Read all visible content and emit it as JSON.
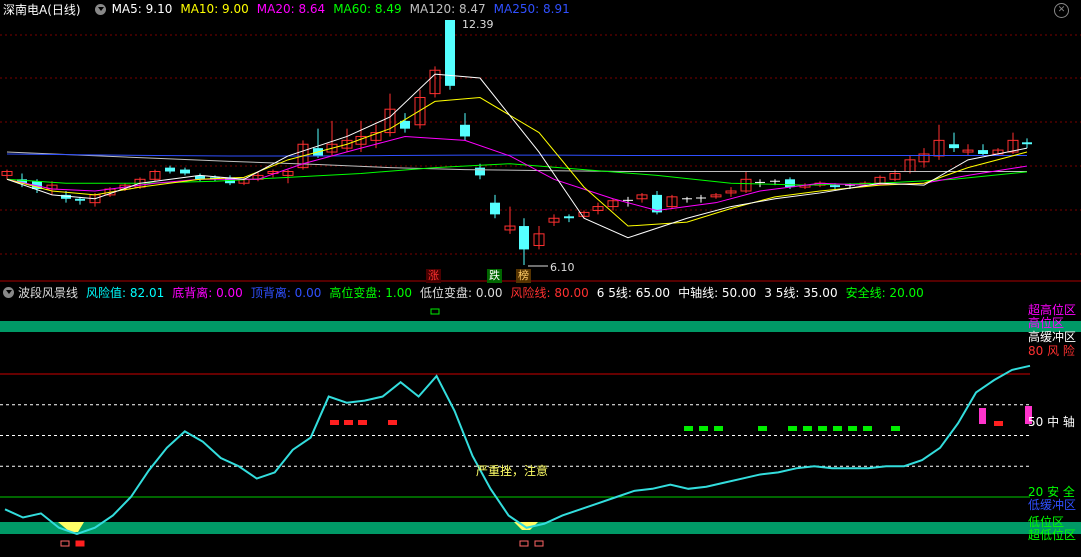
{
  "header": {
    "title": "深南电A(日线)",
    "ma": [
      {
        "label": "MA5: 9.10",
        "color": "#ffffff"
      },
      {
        "label": "MA10: 9.00",
        "color": "#ffff00"
      },
      {
        "label": "MA20: 8.64",
        "color": "#ff00ff"
      },
      {
        "label": "MA60: 8.49",
        "color": "#00ff00"
      },
      {
        "label": "MA120: 8.47",
        "color": "#c0c0c0"
      },
      {
        "label": "MA250: 8.91",
        "color": "#3050ff"
      }
    ]
  },
  "price_chart": {
    "high_label": "12.39",
    "low_label": "6.10",
    "tags": [
      {
        "text": "涨",
        "color": "#ff3030",
        "bg": "#4a0000"
      },
      {
        "text": "跌",
        "color": "#ffffff",
        "bg": "#006600"
      },
      {
        "text": "榜",
        "color": "#ffcc66",
        "bg": "#553300"
      }
    ]
  },
  "indicator": {
    "name": "波段风景线",
    "values": [
      {
        "label": "风险值: 82.01",
        "color": "#00ffff"
      },
      {
        "label": "底背离: 0.00",
        "color": "#ff00ff"
      },
      {
        "label": "顶背离: 0.00",
        "color": "#3050ff"
      },
      {
        "label": "高位变盘: 1.00",
        "color": "#00ff00"
      },
      {
        "label": "低位变盘: 0.00",
        "color": "#dddddd"
      },
      {
        "label": "风险线: 80.00",
        "color": "#ff3030"
      },
      {
        "label": "6 5线: 65.00",
        "color": "#ffffff"
      },
      {
        "label": "中轴线: 50.00",
        "color": "#ffffff"
      },
      {
        "label": "3 5线: 35.00",
        "color": "#ffffff"
      },
      {
        "label": "安全线: 20.00",
        "color": "#00ff00"
      }
    ],
    "zones": [
      {
        "text": "超高位区",
        "color": "#ff00ff"
      },
      {
        "text": "高位区",
        "color": "#ff00ff"
      },
      {
        "text": "高缓冲区",
        "color": "#ffffff"
      },
      {
        "text": "80 风 险",
        "color": "#ff3030"
      },
      {
        "text": "50 中 轴",
        "color": "#ffffff"
      },
      {
        "text": "20 安 全",
        "color": "#00ff00"
      },
      {
        "text": "低缓冲区",
        "color": "#3050ff"
      },
      {
        "text": "低位区",
        "color": "#00ff00"
      },
      {
        "text": "超低位区",
        "color": "#00ff00"
      }
    ],
    "annotation": "严重挫，注意",
    "risk_series": [
      14,
      10,
      12,
      5,
      2,
      5,
      11,
      20,
      33,
      44,
      52,
      47,
      39,
      35,
      29,
      32,
      43,
      49,
      69,
      66,
      67,
      69,
      76,
      69,
      79,
      62,
      40,
      24,
      11,
      5,
      7,
      11,
      14,
      17,
      20,
      23,
      24,
      26,
      24,
      25,
      27,
      29,
      31,
      32,
      34,
      35,
      34,
      34,
      34,
      35,
      35,
      38,
      44,
      56,
      71,
      77,
      82,
      84
    ]
  }
}
